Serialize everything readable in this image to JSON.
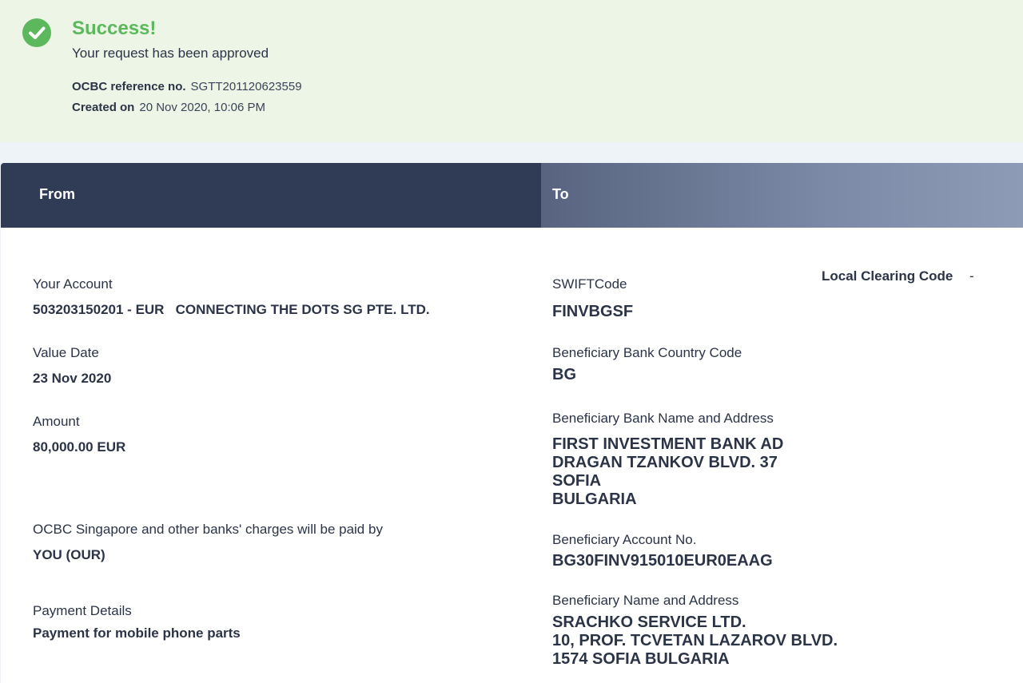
{
  "banner": {
    "title": "Success!",
    "subtitle": "Your request has been approved",
    "reference_label": "OCBC reference no.",
    "reference_value": "SGTT201120623559",
    "created_label": "Created on",
    "created_value": "20 Nov 2020, 10:06 PM",
    "icon": "check-circle-icon",
    "accent_color": "#5cb85c"
  },
  "header": {
    "from_label": "From",
    "to_label": "To"
  },
  "from": {
    "account_label": "Your Account",
    "account_value": "503203150201 - EUR   CONNECTING THE DOTS SG PTE. LTD.",
    "value_date_label": "Value Date",
    "value_date_value": "23 Nov 2020",
    "amount_label": "Amount",
    "amount_value": "80,000.00 EUR",
    "charges_label": "OCBC Singapore and other banks' charges will be paid by",
    "charges_value": "YOU (OUR)",
    "payment_details_label": "Payment Details",
    "payment_details_value": "Payment for mobile phone parts"
  },
  "to": {
    "swift_label": "SWIFTCode",
    "swift_value": "FINVBGSF",
    "local_clearing_label": "Local Clearing Code",
    "local_clearing_value": "-",
    "country_code_label": "Beneficiary Bank Country Code",
    "country_code_value": "BG",
    "bank_name_label": "Beneficiary Bank Name and Address",
    "bank_name_lines": [
      "FIRST INVESTMENT BANK AD",
      "DRAGAN TZANKOV BLVD. 37",
      "SOFIA",
      "BULGARIA"
    ],
    "account_no_label": "Beneficiary Account No.",
    "account_no_value": "BG30FINV915010EUR0EAAG",
    "beneficiary_label": "Beneficiary Name and Address",
    "beneficiary_lines": [
      "SRACHKO SERVICE LTD.",
      "10, PROF. TCVETAN LAZAROV BLVD.",
      "1574 SOFIA BULGARIA"
    ]
  }
}
